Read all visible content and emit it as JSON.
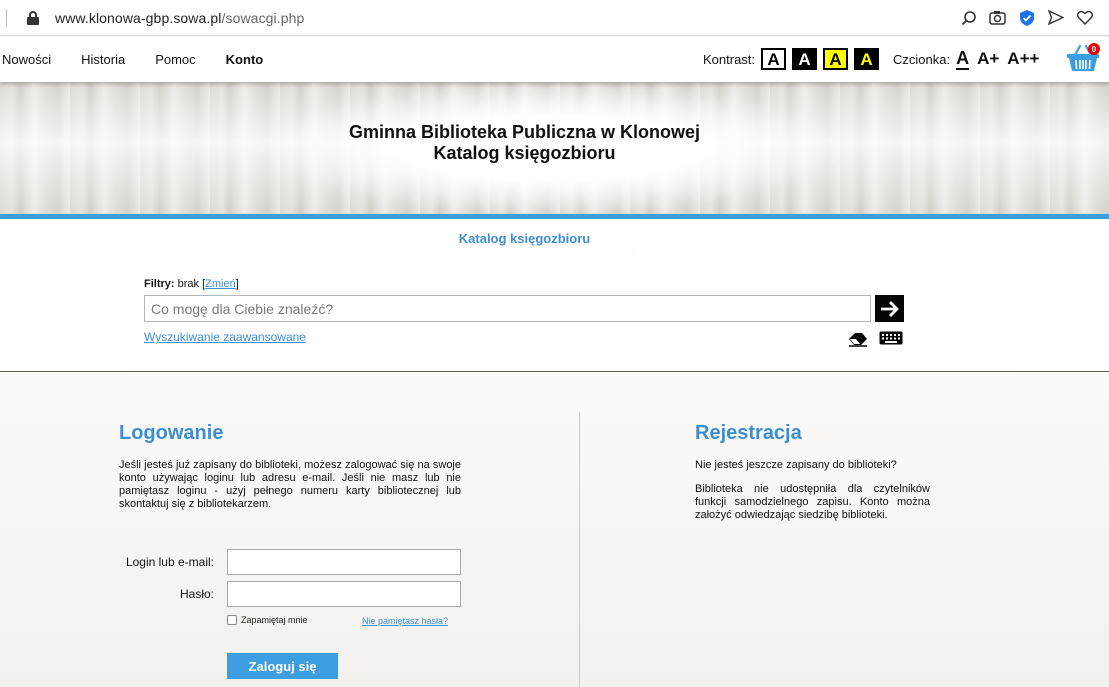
{
  "browser": {
    "url_host": "www.klonowa-gbp.sowa.pl",
    "url_path": "/sowacgi.php"
  },
  "nav": {
    "items": [
      {
        "label": "Nowości"
      },
      {
        "label": "Historia"
      },
      {
        "label": "Pomoc"
      },
      {
        "label": "Konto"
      }
    ],
    "contrast_label": "Kontrast:",
    "contrast_options": [
      "A",
      "A",
      "A",
      "A"
    ],
    "font_label": "Czcionka:",
    "font_options": [
      "A",
      "A+",
      "A++"
    ],
    "basket_count": "0"
  },
  "header": {
    "title_line1": "Gminna Biblioteka Publiczna w Klonowej",
    "title_line2": "Katalog księgozbioru"
  },
  "search": {
    "breadcrumb": "Katalog księgozbioru",
    "filters_label": "Filtry:",
    "filters_value": "brak",
    "filters_change": "Zmień",
    "placeholder": "Co mogę dla Ciebie znaleźć?",
    "advanced_link": "Wyszukiwanie zaawansowane"
  },
  "login": {
    "title": "Logowanie",
    "text": "Jeśli jesteś już zapisany do biblioteki, możesz zalogować się na swoje konto używając loginu lub adresu e-mail. Jeśli nie masz lub nie pamiętasz loginu - użyj pełnego numeru karty bibliotecznej lub skontaktuj się z bibliotekarzem.",
    "login_label": "Login lub e-mail:",
    "password_label": "Hasło:",
    "login_value": "",
    "password_value": "",
    "remember_label": "Zapamiętaj mnie",
    "forgot_link": "Nie pamiętasz hasła?",
    "submit_label": "Zaloguj się"
  },
  "registration": {
    "title": "Rejestracja",
    "question": "Nie jesteś jeszcze zapisany do biblioteki?",
    "text": "Biblioteka nie udostępniła dla czytelników funkcji samodzielnego zapisu. Konto można założyć odwiedzając siedzibę biblioteki."
  },
  "colors": {
    "accent": "#3c9de0",
    "link": "#3a8fd4",
    "basket": "#3c9de0",
    "badge": "#e00000"
  }
}
